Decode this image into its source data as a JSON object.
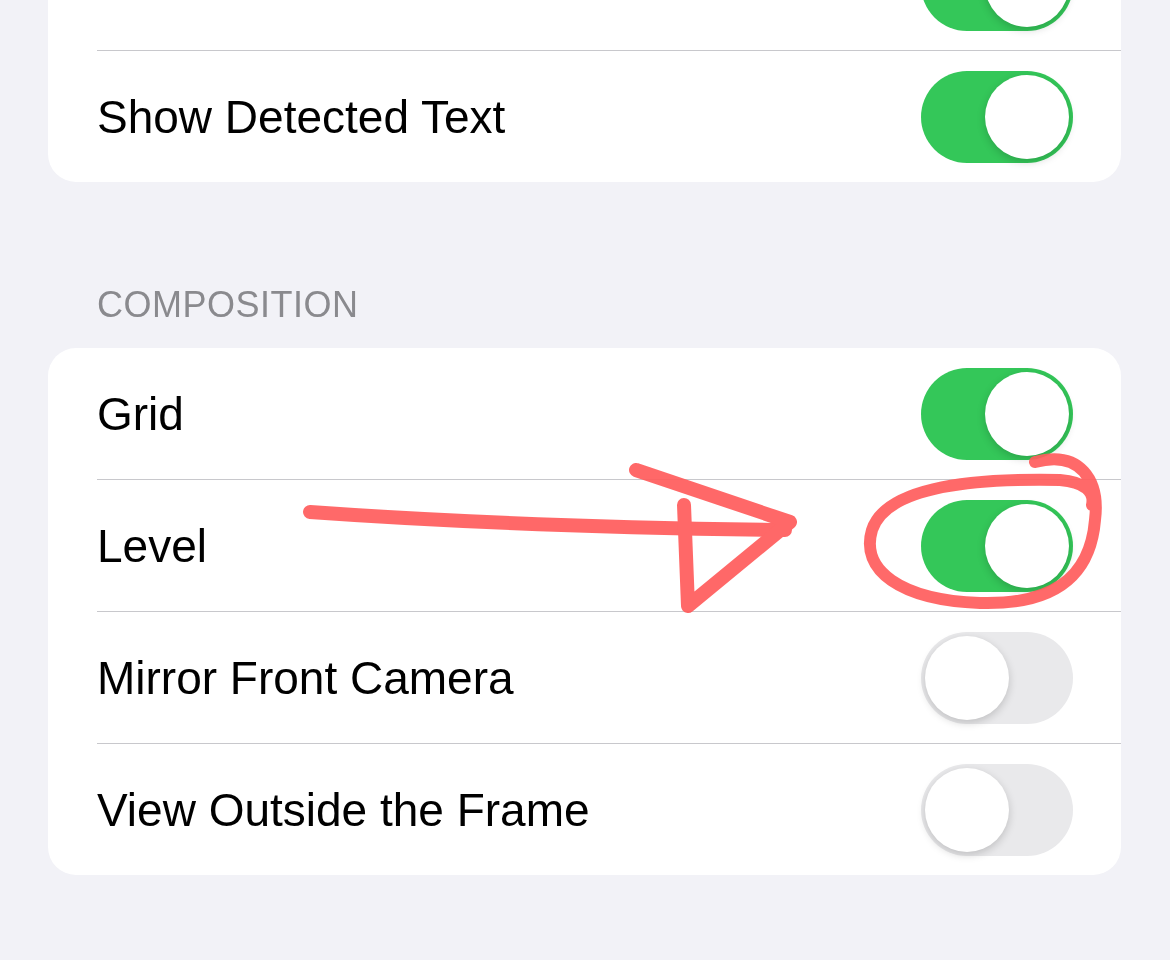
{
  "groups": [
    {
      "rows": [
        {
          "on": true
        },
        {
          "label": "Show Detected Text",
          "on": true
        }
      ]
    },
    {
      "header": "COMPOSITION",
      "rows": [
        {
          "label": "Grid",
          "on": true
        },
        {
          "label": "Level",
          "on": true
        },
        {
          "label": "Mirror Front Camera",
          "on": false
        },
        {
          "label": "View Outside the Frame",
          "on": false
        }
      ]
    }
  ]
}
